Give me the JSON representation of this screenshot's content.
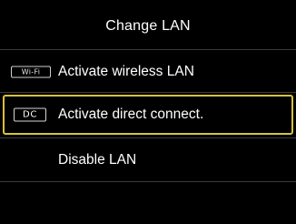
{
  "screen": {
    "title": "Change LAN"
  },
  "menu": {
    "items": [
      {
        "label": "Activate wireless LAN",
        "badge": "Wi-Fi",
        "selected": false
      },
      {
        "label": "Activate direct connect.",
        "badge": "DC",
        "selected": true
      },
      {
        "label": "Disable LAN",
        "badge": "",
        "selected": false
      }
    ]
  },
  "colors": {
    "background": "#000000",
    "text": "#ffffff",
    "selection_border": "#d8c23a",
    "divider": "#3a3a3a"
  }
}
